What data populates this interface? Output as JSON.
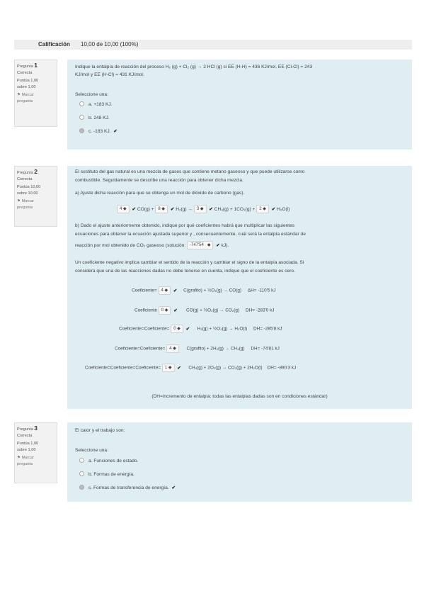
{
  "grade": {
    "label": "Calificación",
    "value": "10,00 de 10,00 (100%)"
  },
  "q1": {
    "title": "Pregunta",
    "number": "1",
    "state": "Correcta",
    "score_line1": "Puntúa 1,00",
    "score_line2": "sobre 1,00",
    "flag_icon": "flag-icon",
    "flag_line1": "Marcar",
    "flag_line2": "pregunta",
    "text_line1": "Indique la entalpía de reacción del proceso H₂ (g) + Cl₂ (g) → 2 HCl (g) si EE (H-H) = 436 KJ/mol, EE (Cl-Cl) = 243",
    "text_line2": "KJ/mol y EE (H-Cl) = 431 KJ/mol.",
    "select_prompt": "Seleccione una:",
    "options": [
      "a. +183 KJ.",
      "b. 248 KJ.",
      "c. -183 KJ."
    ],
    "selected_index": 2
  },
  "q2": {
    "title": "Pregunta",
    "number": "2",
    "state": "Correcta",
    "score_line1": "Puntúa 10,00",
    "score_line2": "sobre 10,00",
    "flag_line1": "Marcar",
    "flag_line2": "pregunta",
    "intro_line1": "El sustituto del gas natural es una mezcla de gases que contiene metano gaseoso y que puede utilizarse como",
    "intro_line2": "combustible. Seguidamente se describe una reacción para obtener dicha mezcla.",
    "part_a": "a) Ajuste dicha reacción para que se obtenga un mol de dióxido de carbono (gas).",
    "eq_a": {
      "c1": "4",
      "s1": "CO(g) +",
      "c2": "8",
      "s2": "H₂(g) →",
      "c3": "3",
      "s3": "CH₄(g) + 1CO₂(g) +",
      "c4": "2",
      "s4": "H₂O(l)"
    },
    "part_b_line1": "b) Dado el ajuste anteriormente obtenido, indique por qué coeficientes habrá que multiplicar las siguientes",
    "part_b_line2": "ecuaciones para obtener la ecuación ajustada superior y , consecuentemente, cuál será la entalpía estándar de",
    "part_b_line3_pre": "reacción por mol obtenido de CO₂ gaseoso (solución:",
    "part_b_answer": "-747'54",
    "part_b_line3_post": "kJ).",
    "neg_line1": "Un coeficiente negativo implica cambiar el sentido de la reacción y cambiar el signo de la entalpía asociada. Si",
    "neg_line2": "considera que una de las reacciones dadas no debe tenerse en cuenta, indique que el coeficiente es cero.",
    "rows": [
      {
        "label": "Coeficiente=",
        "coef": "4",
        "eq": "C(grafito) + ½O₂(g) → CO(g)",
        "dh": "ΔH= -110'5 kJ"
      },
      {
        "label": "Coeficiente",
        "coef": "0",
        "eq": "CO(g) + ½O₂(g) → CO₂(g)",
        "dh": "DH= -283'0 kJ"
      },
      {
        "label": "Coeficiente=Coeficiente=",
        "coef": "0",
        "eq": "H₂(g) + ½O₂(g) → H₂O(l)",
        "dh": "DH= -285'8 kJ"
      },
      {
        "label": "Coeficiente=Coeficiente=",
        "coef": "4",
        "eq": "C(grafito) + 2H₂(g) → CH₄(g)",
        "dh": "DH= -74'81 kJ"
      },
      {
        "label": "Coeficiente=Coeficiente=Coeficiente=",
        "coef": "1",
        "eq": "CH₄(g) + 2O₂(g) → CO₂(g) + 2H₂O(l)",
        "dh": "DH= -890'3 kJ"
      }
    ],
    "footer": "(DH=incremento de entalpia: todas las entalpias dadas son en condiciones estándar)"
  },
  "q3": {
    "title": "Pregunta",
    "number": "3",
    "state": "Correcta",
    "score_line1": "Puntúa 1,00",
    "score_line2": "sobre 1,00",
    "flag_line1": "Marcar",
    "flag_line2": "pregunta",
    "text": "El calor y el trabajo son:",
    "select_prompt": "Seleccione una:",
    "options": [
      "a. Funciones de estado.",
      "b. Formas de energía.",
      "c. Formas de transferencia de energía."
    ],
    "selected_index": 2
  },
  "icons": {
    "check": "✔",
    "select_caret": "◆"
  }
}
